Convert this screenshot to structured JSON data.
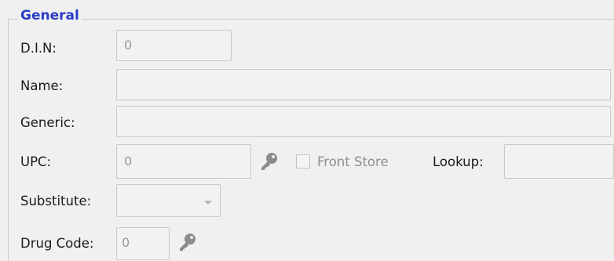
{
  "group": {
    "title": "General"
  },
  "fields": {
    "din": {
      "label": "D.I.N:",
      "value": "0"
    },
    "name": {
      "label": "Name:",
      "value": ""
    },
    "generic": {
      "label": "Generic:",
      "value": ""
    },
    "upc": {
      "label": "UPC:",
      "value": "0"
    },
    "front_store": {
      "label": "Front Store",
      "checked": false
    },
    "lookup": {
      "label": "Lookup:",
      "value": ""
    },
    "substitute": {
      "label": "Substitute:",
      "value": ""
    },
    "drug_code": {
      "label": "Drug Code:",
      "value": "0"
    }
  },
  "icons": {
    "upc_key": "key-icon",
    "drug_code_key": "key-icon"
  }
}
